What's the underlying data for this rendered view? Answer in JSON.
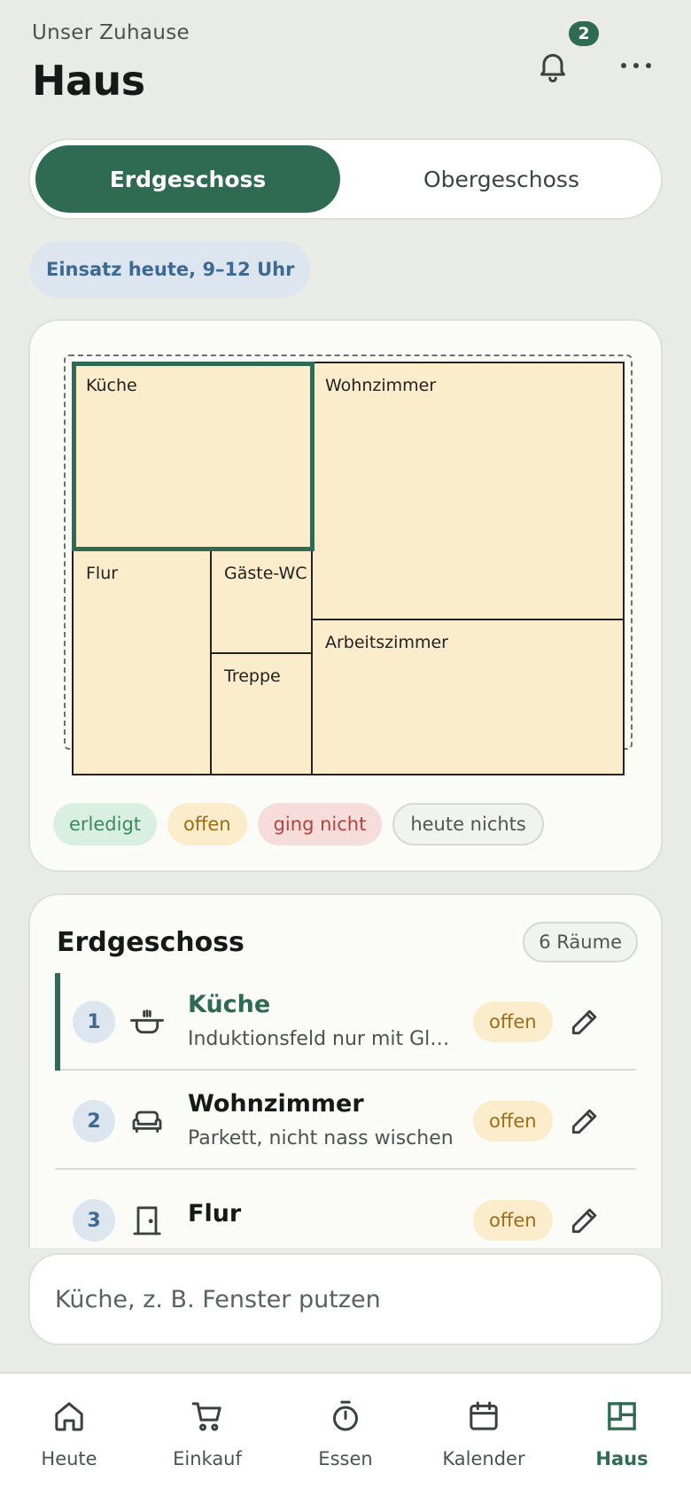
{
  "header": {
    "household": "Unser Zuhause",
    "title": "Haus",
    "notifications_count": "2"
  },
  "floors": {
    "active": "Erdgeschoss",
    "inactive": "Obergeschoss"
  },
  "info_chip": "Einsatz heute, 9–12 Uhr",
  "floorplan": {
    "rooms": {
      "kueche": "Küche",
      "wohnzimmer": "Wohnzimmer",
      "flur": "Flur",
      "gaeste_wc": "Gäste-WC",
      "treppe": "Treppe",
      "arbeitszimmer": "Arbeitszimmer"
    },
    "selected_room": "Küche",
    "legend": {
      "done": "erledigt",
      "open": "offen",
      "failed": "ging nicht",
      "none": "heute nichts"
    }
  },
  "room_list": {
    "title": "Erdgeschoss",
    "count": "6 Räume",
    "rows": [
      {
        "num": "1",
        "icon": "pot-icon",
        "name": "Küche",
        "note": "Induktionsfeld nur mit Glaskeramikreiniger",
        "status": "offen"
      },
      {
        "num": "2",
        "icon": "sofa-icon",
        "name": "Wohnzimmer",
        "note": "Parkett, nicht nass wischen",
        "status": "offen"
      },
      {
        "num": "3",
        "icon": "door-icon",
        "name": "Flur",
        "note": "",
        "status": "offen"
      }
    ]
  },
  "quick_add": {
    "placeholder": "Küche, z. B. Fenster putzen"
  },
  "nav": {
    "items": [
      "Heute",
      "Einkauf",
      "Essen",
      "Kalender",
      "Haus"
    ],
    "active": "Haus"
  },
  "colors": {
    "accent": "#2f6b52",
    "room_fill": "#fbeccb",
    "info_blue": "#3c6a95"
  }
}
